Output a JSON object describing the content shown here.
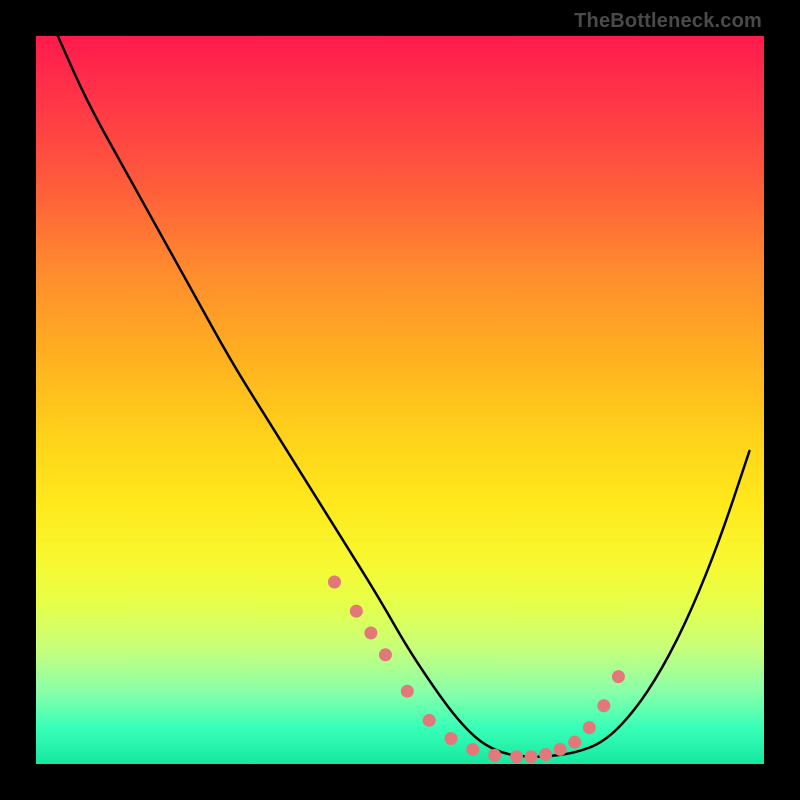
{
  "watermark": "TheBottleneck.com",
  "colors": {
    "gradient_top": "#ff1a4d",
    "gradient_mid": "#ffe81c",
    "gradient_bottom": "#16e8a0",
    "curve": "#000000",
    "dot": "#e2787a",
    "frame": "#000000"
  },
  "chart_data": {
    "type": "line",
    "title": "",
    "xlabel": "",
    "ylabel": "",
    "xlim": [
      0,
      100
    ],
    "ylim": [
      0,
      100
    ],
    "note": "No axis ticks or numeric labels are rendered; values below are estimated from pixel positions on a 0–100 normalized scale (0 = left/bottom, 100 = right/top).",
    "series": [
      {
        "name": "bottleneck-curve",
        "x": [
          3,
          7,
          12,
          17,
          22,
          27,
          32,
          37,
          42,
          47,
          51,
          55,
          58,
          61,
          64,
          67,
          70,
          74,
          78,
          82,
          86,
          90,
          94,
          98
        ],
        "values": [
          100,
          91,
          82,
          73,
          64,
          55,
          47,
          39,
          31,
          23,
          16,
          10,
          6,
          3,
          1.5,
          1,
          1,
          1.5,
          3,
          7,
          13,
          21,
          31,
          43
        ]
      }
    ],
    "markers": {
      "name": "near-minimum-dots",
      "x": [
        41,
        44,
        46,
        48,
        51,
        54,
        57,
        60,
        63,
        66,
        68,
        70,
        72,
        74,
        76,
        78,
        80
      ],
      "values": [
        25,
        21,
        18,
        15,
        10,
        6,
        3.5,
        2,
        1.2,
        1,
        1,
        1.3,
        2,
        3,
        5,
        8,
        12
      ]
    }
  }
}
